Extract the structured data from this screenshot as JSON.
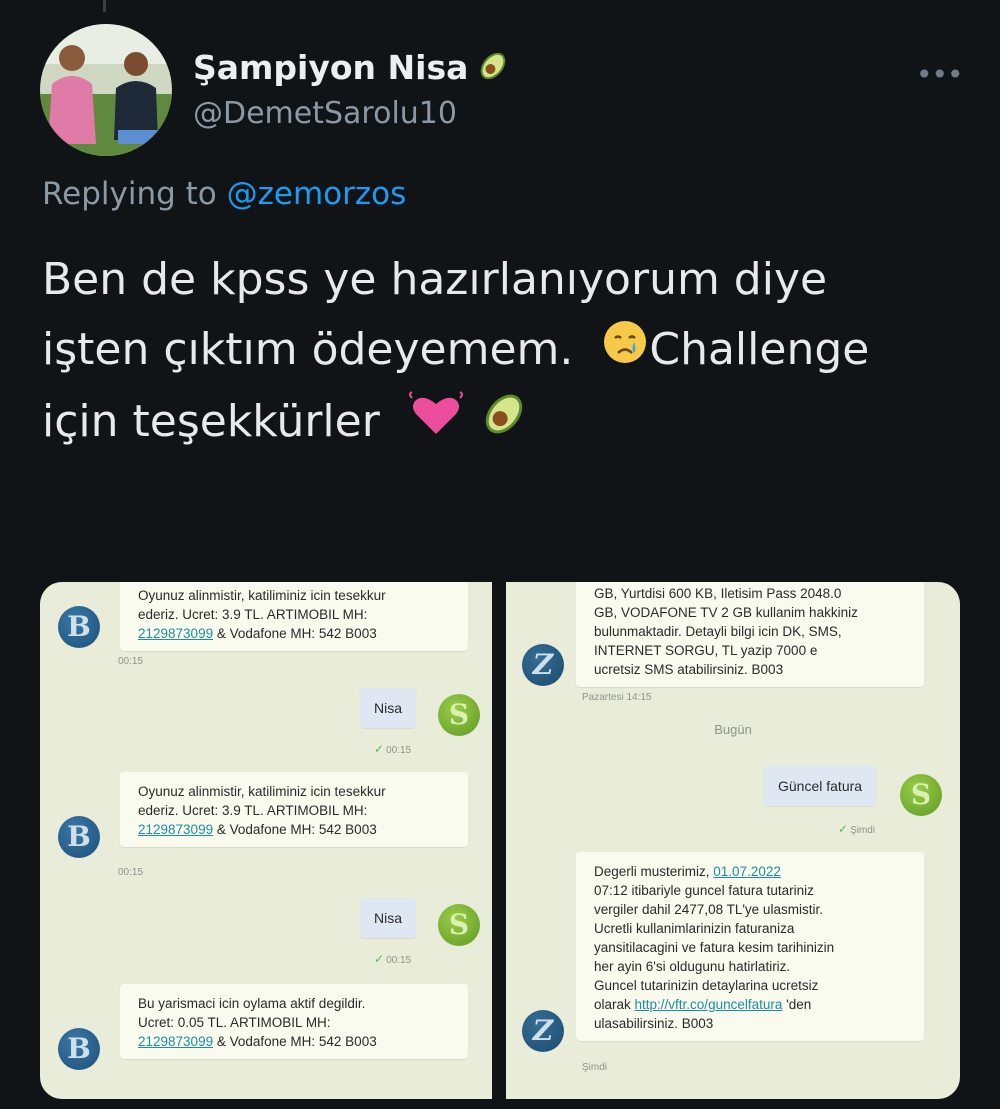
{
  "tweet": {
    "display_name": "Şampiyon Nisa",
    "handle": "@DemetSarolu10",
    "more_label": "•••",
    "replying_prefix": "Replying to",
    "replying_mention": "@zemorzos",
    "text_line1": "Ben de kpss ye hazırlanıyorum diye",
    "text_line2a": "işten çıktım ödeyemem.",
    "text_line2b": "Challenge",
    "text_line3": "için teşekkürler",
    "emoji": [
      "avocado",
      "crying-face",
      "growing-heart",
      "avocado"
    ]
  },
  "left_chat": {
    "contact_initial": "B",
    "my_initial": "S",
    "msg1": {
      "lines": [
        "Oyunuz alinmistir, katiliminiz icin tesekkur",
        "ederiz. Ucret: 3.9 TL. ARTIMOBIL MH:"
      ],
      "link": "2129873099",
      "tail": " & Vodafone MH: 542 B003",
      "time": "00:15"
    },
    "sent1": {
      "text": "Nisa",
      "time": "00:15"
    },
    "msg2": {
      "lines": [
        "Oyunuz alinmistir, katiliminiz icin tesekkur",
        "ederiz. Ucret: 3.9 TL. ARTIMOBIL MH:"
      ],
      "link": "2129873099",
      "tail": " & Vodafone MH: 542 B003",
      "time": "00:15"
    },
    "sent2": {
      "text": "Nisa",
      "time": "00:15"
    },
    "msg3": {
      "lines": [
        "Bu yarismaci icin oylama aktif degildir.",
        "Ucret: 0.05 TL. ARTIMOBIL MH:"
      ],
      "link": "2129873099",
      "tail": " & Vodafone MH: 542 B003"
    }
  },
  "right_chat": {
    "contact_initial": "Z",
    "my_initial": "S",
    "msg1": {
      "lines": [
        "GB, Yurtdisi 600 KB, Iletisim Pass 2048.0",
        "GB, VODAFONE TV 2 GB kullanim hakkiniz",
        "bulunmaktadir. Detayli bilgi icin DK, SMS,",
        "INTERNET SORGU, TL yazip 7000 e",
        "ucretsiz SMS atabilirsiniz. B003"
      ],
      "time": "Pazartesi 14:15"
    },
    "day_label": "Bugün",
    "sent1": {
      "text": "Güncel fatura",
      "time": "Şimdi"
    },
    "msg2": {
      "line1_prefix": "Degerli musterimiz, ",
      "line1_link": "01.07.2022",
      "lines": [
        "07:12 itibariyle guncel fatura tutariniz",
        "vergiler dahil 2477,08 TL'ye ulasmistir.",
        "Ucretli kullanimlarinizin faturaniza",
        "yansitilacagini ve fatura kesim tarihinizin",
        "her ayin 6'si oldugunu hatirlatiriz.",
        "Guncel tutarinizin detaylarina ucretsiz"
      ],
      "link_prefix": "olarak ",
      "link": "http://vftr.co/guncelfatura",
      "link_suffix": " 'den",
      "last_line": "ulasabilirsiniz. B003",
      "time": "Şimdi"
    }
  }
}
